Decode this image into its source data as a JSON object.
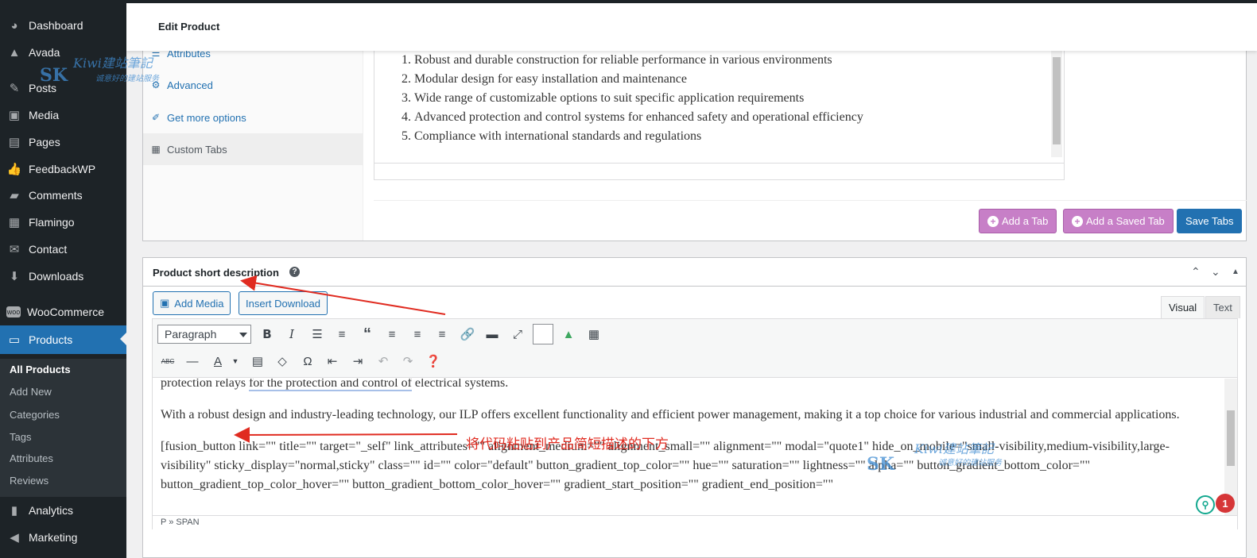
{
  "sidebar": {
    "items": [
      {
        "label": "Dashboard",
        "icon": "dashboard-icon"
      },
      {
        "label": "Avada",
        "icon": "avada-icon"
      },
      {
        "label": "Posts",
        "icon": "pin-icon"
      },
      {
        "label": "Media",
        "icon": "media-icon"
      },
      {
        "label": "Pages",
        "icon": "pages-icon"
      },
      {
        "label": "FeedbackWP",
        "icon": "thumbs-up-icon"
      },
      {
        "label": "Comments",
        "icon": "comment-icon"
      },
      {
        "label": "Flamingo",
        "icon": "flamingo-icon"
      },
      {
        "label": "Contact",
        "icon": "mail-icon"
      },
      {
        "label": "Downloads",
        "icon": "download-icon"
      },
      {
        "label": "WooCommerce",
        "icon": "woo-icon"
      },
      {
        "label": "Products",
        "icon": "archive-icon"
      },
      {
        "label": "Analytics",
        "icon": "chart-icon"
      },
      {
        "label": "Marketing",
        "icon": "megaphone-icon"
      }
    ],
    "submenu": [
      "All Products",
      "Add New",
      "Categories",
      "Tags",
      "Attributes",
      "Reviews"
    ]
  },
  "header": {
    "title": "Edit Product"
  },
  "product_data": {
    "tabs": [
      "Attributes",
      "Advanced",
      "Get more options",
      "Custom Tabs"
    ],
    "list": [
      "Robust and durable construction for reliable performance in various environments",
      "Modular design for easy installation and maintenance",
      "Wide range of customizable options to suit specific application requirements",
      "Advanced protection and control systems for enhanced safety and operational efficiency",
      "Compliance with international standards and regulations"
    ],
    "buttons": {
      "add_tab": "Add a Tab",
      "add_saved_tab": "Add a Saved Tab",
      "save_tabs": "Save Tabs"
    }
  },
  "short_description": {
    "title": "Product short description",
    "add_media": "Add Media",
    "insert_download": "Insert Download",
    "tab_visual": "Visual",
    "tab_text": "Text",
    "format": "Paragraph",
    "content": {
      "p1a": "protection relays ",
      "p1b": "for the protection and control of",
      "p1c": " electrical systems.",
      "p2": "With a robust design and industry-leading technology, our ILP offers excellent functionality and efficient power management, making it a top choice for various industrial and commercial applications.",
      "p3": "[fusion_button link=\"\" title=\"\" target=\"_self\" link_attributes=\"\" alignment_medium=\"\" alignment_small=\"\" alignment=\"\" modal=\"quote1\" hide_on_mobile=\"small-visibility,medium-visibility,large-visibility\" sticky_display=\"normal,sticky\" class=\"\" id=\"\" color=\"default\" button_gradient_top_color=\"\" hue=\"\" saturation=\"\" lightness=\"\" alpha=\"\" button_gradient_bottom_color=\"\" button_gradient_top_color_hover=\"\" button_gradient_bottom_color_hover=\"\" gradient_start_position=\"\" gradient_end_position=\"\""
    },
    "status_path": "P » SPAN",
    "badge_count": "1"
  },
  "annotation": {
    "text": "将代码粘贴到产品简短描述的下方"
  },
  "watermark": {
    "text": "Kiwi建站筆記",
    "sub": "诚意好的建站服务"
  },
  "colors": {
    "accent": "#2271b1",
    "sidebar_bg": "#1d2327",
    "purple": "#c77fc7",
    "annotation": "#e02b20"
  }
}
